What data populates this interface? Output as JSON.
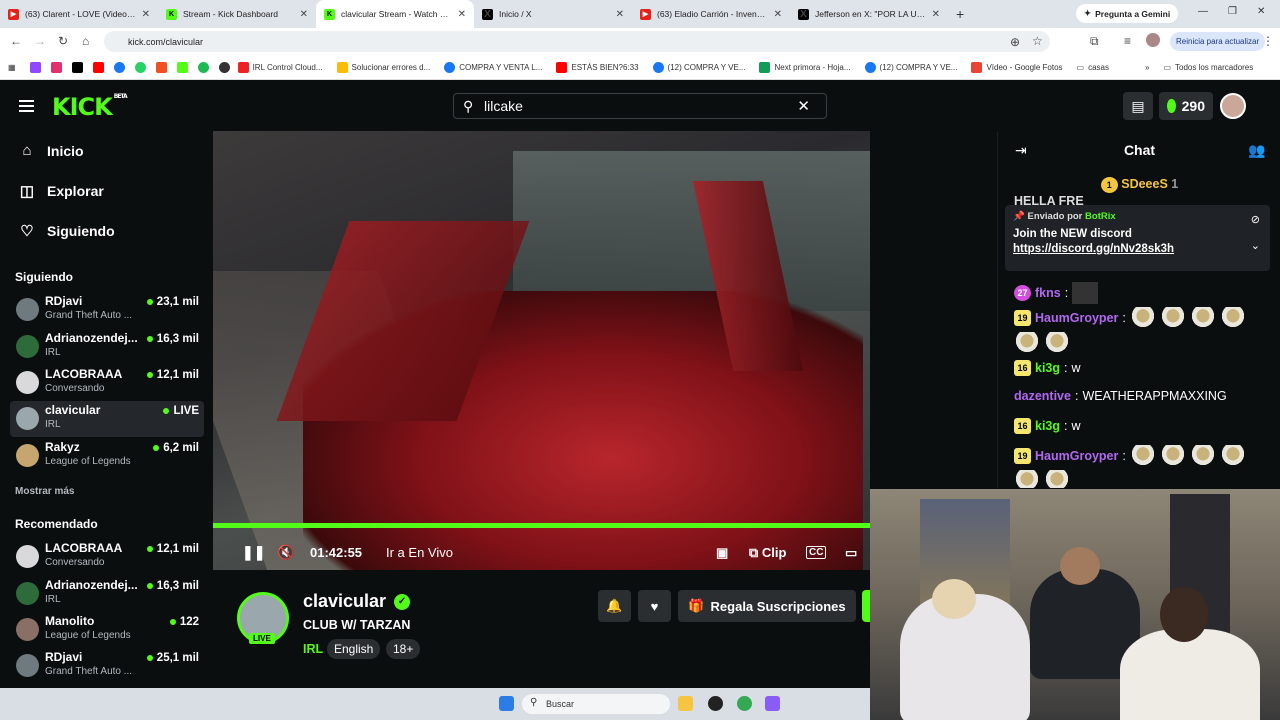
{
  "browser": {
    "tabs": [
      {
        "title": "(63) Clarent - LOVE (Video Ofic",
        "icon": "youtube-icon"
      },
      {
        "title": "Stream - Kick Dashboard",
        "icon": "kick-icon"
      },
      {
        "title": "clavicular Stream - Watch Live o",
        "icon": "kick-icon"
      },
      {
        "title": "Inicio / X",
        "icon": "x-icon"
      },
      {
        "title": "(63) Eladio Carrión - Invencible",
        "icon": "youtube-icon"
      },
      {
        "title": "Jefferson en X: \"POR LA ULTIMA",
        "icon": "x-icon"
      }
    ],
    "gemini_label": "Pregunta a Gemini",
    "url": "kick.com/clavicular",
    "update_label": "Reinicia para actualizar",
    "bookmarks": [
      "IRL Control Cloud...",
      "Solucionar errores d...",
      "COMPRA Y VENTA L...",
      "ESTÁS BIEN?6:33",
      "(12) COMPRA Y VE...",
      "Next primora - Hoja...",
      "(12) COMPRA Y VE...",
      "Vídeo - Google Fotos",
      "casas"
    ],
    "all_bookmarks": "Todos los marcadores"
  },
  "header": {
    "logo": "KICK",
    "logo_sup": "BETA",
    "search_value": "lilcake",
    "points": "290"
  },
  "sidebar": {
    "nav": [
      {
        "label": "Inicio",
        "icon": "home-icon"
      },
      {
        "label": "Explorar",
        "icon": "compass-icon"
      },
      {
        "label": "Siguiendo",
        "icon": "heart-icon"
      }
    ],
    "following_heading": "Siguiendo",
    "following": [
      {
        "name": "RDjavi",
        "sub": "Grand Theft Auto ...",
        "viewers": "23,1 mil"
      },
      {
        "name": "Adrianozendej...",
        "sub": "IRL",
        "viewers": "16,3 mil"
      },
      {
        "name": "LACOBRAAA",
        "sub": "Conversando",
        "viewers": "12,1 mil"
      },
      {
        "name": "clavicular",
        "sub": "IRL",
        "viewers": "LIVE"
      },
      {
        "name": "Rakyz",
        "sub": "League of Legends",
        "viewers": "6,2 mil"
      }
    ],
    "show_more": "Mostrar más",
    "recommended_heading": "Recomendado",
    "recommended": [
      {
        "name": "LACOBRAAA",
        "sub": "Conversando",
        "viewers": "12,1 mil"
      },
      {
        "name": "Adrianozendej...",
        "sub": "IRL",
        "viewers": "16,3 mil"
      },
      {
        "name": "Manolito",
        "sub": "League of Legends",
        "viewers": "122"
      },
      {
        "name": "RDjavi",
        "sub": "Grand Theft Auto ...",
        "viewers": "25,1 mil"
      }
    ]
  },
  "player": {
    "time": "01:42:55",
    "go_live": "Ir a En Vivo",
    "clip": "Clip",
    "cc": "CC",
    "progress": 1.0
  },
  "channel": {
    "name": "clavicular",
    "live": "LIVE",
    "title": "CLUB W/ TARZAN",
    "category": "IRL",
    "tags": [
      "English",
      "18+"
    ],
    "gift_subs": "Regala Suscripciones"
  },
  "chat": {
    "title": "Chat",
    "gifter": {
      "name": "SDeeeS",
      "count": "1",
      "badge": "1"
    },
    "partial_line": "HELLA FRE",
    "pinned": {
      "sent_by": "Enviado por",
      "author": "BotRix",
      "message": "Join the NEW discord",
      "link": "https://discord.gg/nNv28sk3h"
    },
    "messages": [
      {
        "badge": "27",
        "user": "fkns",
        "text": ""
      },
      {
        "badge": "19",
        "user": "HaumGroyper",
        "text": ""
      },
      {
        "badge": "16",
        "user": "ki3g",
        "text": "w"
      },
      {
        "badge": "",
        "user": "dazentive",
        "text": "WEATHERAPPMAXXING"
      },
      {
        "badge": "16",
        "user": "ki3g",
        "text": "w"
      },
      {
        "badge": "19",
        "user": "HaumGroyper",
        "text": ""
      }
    ]
  },
  "taskbar": {
    "search_placeholder": "Buscar"
  },
  "colors": {
    "accent": "#53fc18",
    "background": "#0b0e0f",
    "user_purple": "#b168f0",
    "user_green": "#53fc18"
  }
}
